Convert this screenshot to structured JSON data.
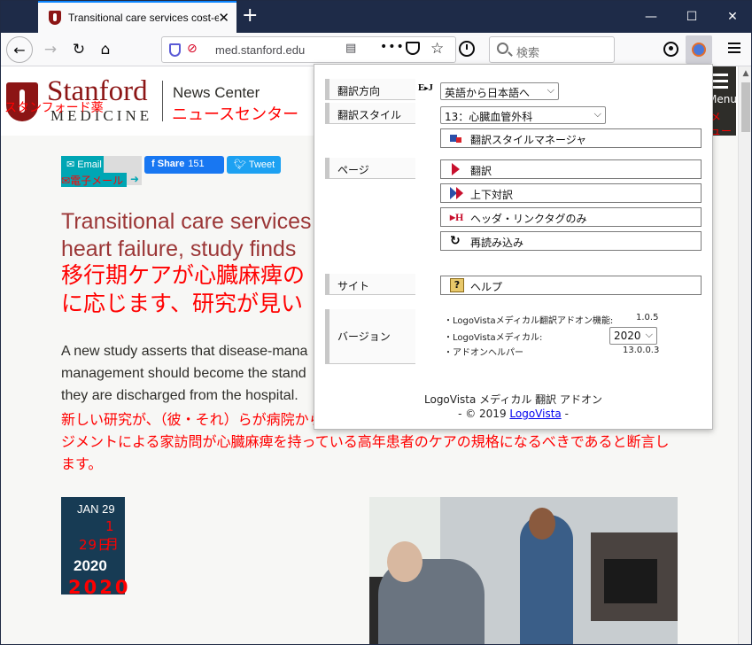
{
  "browser": {
    "tab_title": "Transitional care services cost-e",
    "tab_close": "✕",
    "new_tab": "+",
    "url": "med.stanford.edu",
    "search_placeholder": "検索",
    "window_controls": {
      "minimize": "—",
      "maximize": "☐",
      "close": "✕"
    }
  },
  "site": {
    "logo_stanford": "Stanford",
    "logo_medicine": "MEDICINE",
    "logo_jp": "スタンフォード薬",
    "news_center": "News Center",
    "news_center_jp": "ニュースセンター",
    "menu_label": "Menu",
    "menu_jp_1": "メ",
    "menu_jp_2": "ュー"
  },
  "share": {
    "email": "Email",
    "email_jp": "電子メール",
    "facebook": "Share",
    "facebook_count": "151",
    "twitter": "Tweet"
  },
  "article": {
    "headline_en_1": "Transitional care services",
    "headline_en_2": "heart failure, study finds",
    "headline_jp_1": "移行期ケアが心臓麻痺の",
    "headline_jp_2": "に応じます、研究が見い",
    "body_en_1": "A new study asserts that disease-mana",
    "body_en_2": "management should become the stand",
    "body_en_3": "they are discharged from the hospital.",
    "body_jp": "新しい研究が、（彼・それ）らが病院から退院させられた後、疾患管理診療所と看護師症例マネージメントによる家訪問が心臓麻痺を持っている高年患者のケアの規格になるべきであると断言します。",
    "date_month": "JAN 29",
    "date_jp_1": "1月",
    "date_jp_2": "29日",
    "date_year": "2020",
    "date_year_jp": "2020"
  },
  "addon": {
    "sections": {
      "direction": "翻訳方向",
      "style": "翻訳スタイル",
      "page": "ページ",
      "site": "サイト",
      "version": "バージョン"
    },
    "ej_icon": "EₘJ",
    "direction_value": "英語から日本語へ",
    "style_value": "13：心臓血管外科",
    "buttons": {
      "style_manager": "翻訳スタイルマネージャ",
      "translate": "翻訳",
      "parallel": "上下対訳",
      "header_links": "ヘッダ・リンクタグのみ",
      "reload": "再読み込み",
      "help": "ヘルプ"
    },
    "versions": {
      "addon_label": "・LogoVistaメディカル翻訳アドオン機能:",
      "addon_value": "1.0.5",
      "medical_label": "・LogoVistaメディカル:",
      "medical_value": "2020",
      "helper_label": "・アドオンヘルパー",
      "helper_value": "13.0.0.3"
    },
    "footer_title": "LogoVista メディカル 翻訳 アドオン",
    "footer_copyright_prefix": "- © 2019 ",
    "footer_link": "LogoVista",
    "footer_suffix": " -"
  }
}
